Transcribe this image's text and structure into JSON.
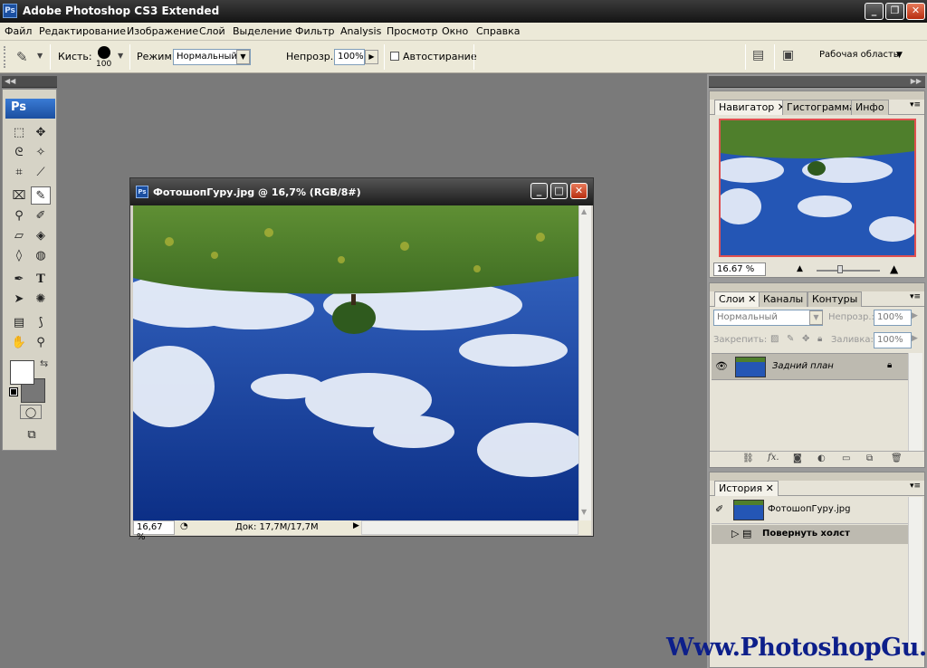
{
  "app": {
    "title": "Adobe Photoshop CS3 Extended",
    "logo": "Ps"
  },
  "window_controls": {
    "minimize": "_",
    "restore": "❐",
    "close": "✕"
  },
  "menu": [
    "Файл",
    "Редактирование",
    "Изображение",
    "Слой",
    "Выделение",
    "Фильтр",
    "Analysis",
    "Просмотр",
    "Окно",
    "Справка"
  ],
  "options": {
    "brush_label": "Кисть:",
    "brush_size": "100",
    "mode_label": "Режим:",
    "mode_value": "Нормальный",
    "opacity_label": "Непрозр.:",
    "opacity_value": "100%",
    "auto_erase_label": "Автостирание",
    "workspace_label": "Рабочая область"
  },
  "document": {
    "title": "ФотошопГуру.jpg @ 16,7% (RGB/8#)",
    "zoom": "16,67 %",
    "doc_info": "Док: 17,7М/17,7М"
  },
  "navigator": {
    "tabs": [
      "Навигатор",
      "Гистограмма",
      "Инфо"
    ],
    "zoom": "16.67 %"
  },
  "layers": {
    "tabs": [
      "Слои",
      "Каналы",
      "Контуры"
    ],
    "blend_mode": "Нормальный",
    "opacity_label": "Непрозр.:",
    "opacity_value": "100%",
    "lock_label": "Закрепить:",
    "fill_label": "Заливка:",
    "fill_value": "100%",
    "layer_name": "Задний план"
  },
  "history": {
    "tab": "История",
    "snapshot": "ФотошопГуру.jpg",
    "step": "Повернуть холст"
  },
  "watermark": "Www.PhotoshopGu.ru",
  "colors": {
    "accent": "#1b4fa0",
    "nav_frame": "#e05050",
    "close_red": "#d9402a"
  }
}
